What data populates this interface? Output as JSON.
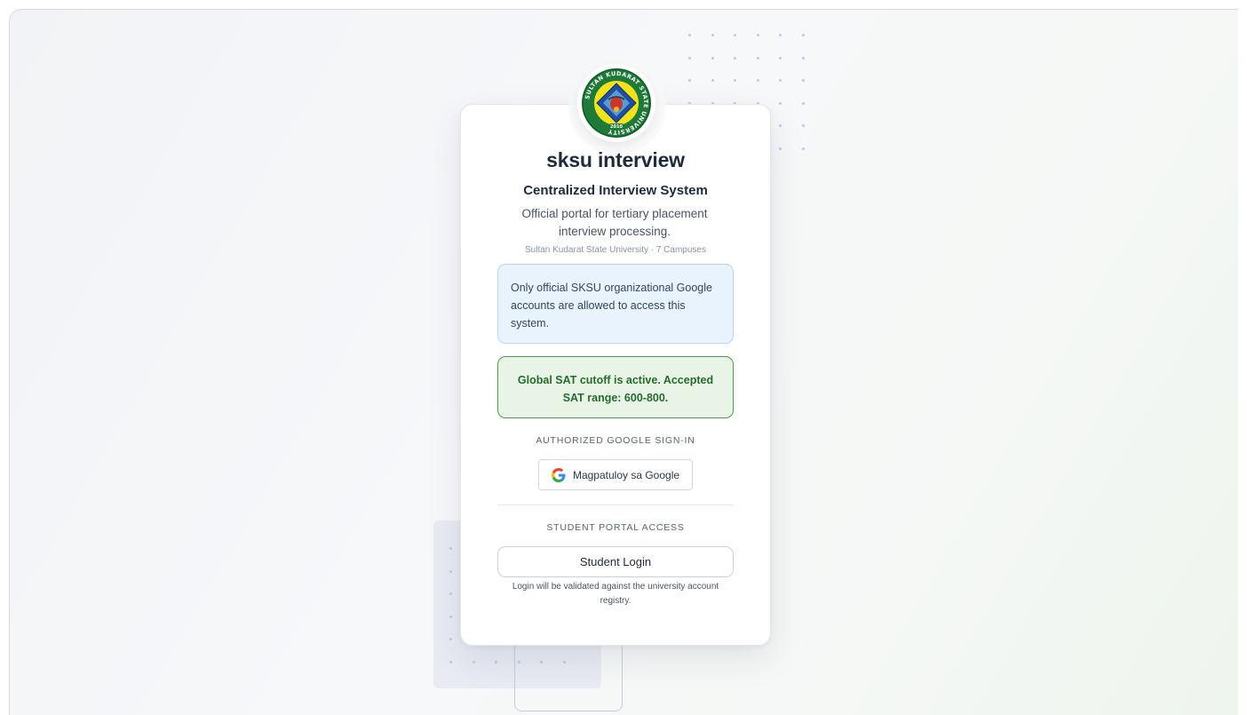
{
  "app": {
    "title": "sksu interview",
    "subtitle": "Centralized Interview System",
    "description": "Official portal for tertiary placement interview processing.",
    "campus_line": "Sultan Kudarat State University · 7 Campuses"
  },
  "logo": {
    "ring_text": "SULTAN KUDARAT STATE UNIVERSITY",
    "year": "2010",
    "colors": {
      "ring": "#1f7a3a",
      "field": "#f2e21c",
      "diamond": "#1f4fa3"
    }
  },
  "notices": {
    "info": "Only official SKSU organizational Google accounts are allowed to access this system.",
    "sat": "Global SAT cutoff is active. Accepted SAT range: 600-800."
  },
  "google_section": {
    "label": "AUTHORIZED GOOGLE SIGN-IN",
    "button_label": "Magpatuloy sa Google",
    "icon": "google-g-icon"
  },
  "student_section": {
    "label": "STUDENT PORTAL ACCESS",
    "button_label": "Student Login",
    "note": "Login will be validated against the university account registry."
  },
  "colors": {
    "info_bg": "#e9f3fd",
    "success_bg": "#e7f4e6",
    "success_text": "#276b2d",
    "heading": "#1d2b3d"
  }
}
